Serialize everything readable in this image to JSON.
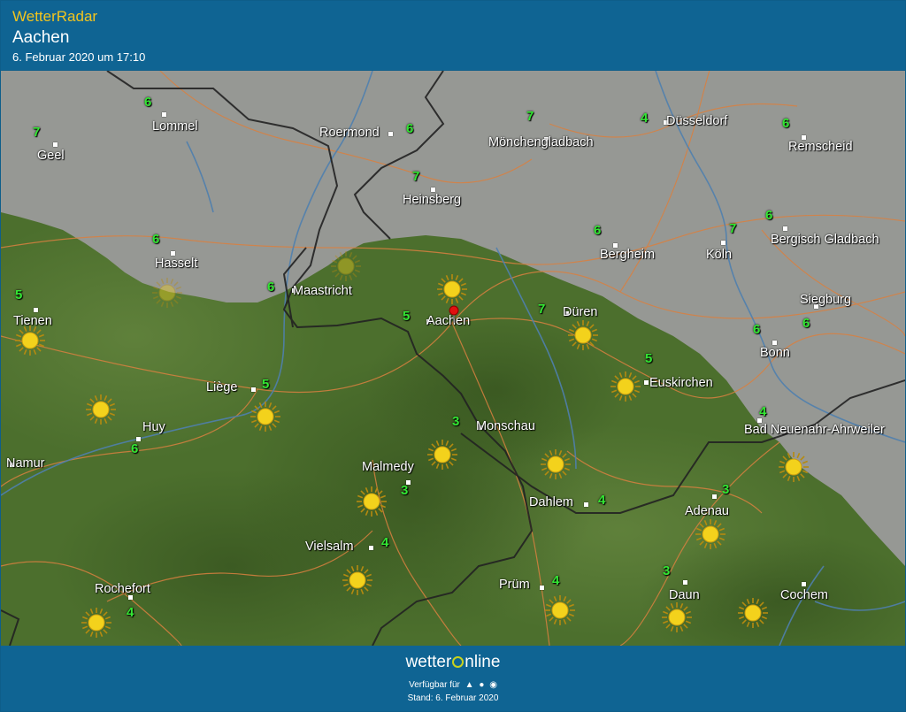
{
  "header": {
    "app_title": "WetterRadar",
    "location": "Aachen",
    "datetime": "6. Februar 2020 um 17:10"
  },
  "map": {
    "places": [
      {
        "name": "Lommel"
      },
      {
        "name": "Geel"
      },
      {
        "name": "Roermond"
      },
      {
        "name": "Mönchengladbach"
      },
      {
        "name": "Düsseldorf"
      },
      {
        "name": "Remscheid"
      },
      {
        "name": "Heinsberg"
      },
      {
        "name": "Hasselt"
      },
      {
        "name": "Bergheim"
      },
      {
        "name": "Köln"
      },
      {
        "name": "Bergisch Gladbach"
      },
      {
        "name": "Maastricht"
      },
      {
        "name": "Tienen"
      },
      {
        "name": "Aachen"
      },
      {
        "name": "Düren"
      },
      {
        "name": "Siegburg"
      },
      {
        "name": "Bonn"
      },
      {
        "name": "Liège"
      },
      {
        "name": "Euskirchen"
      },
      {
        "name": "Huy"
      },
      {
        "name": "Monschau"
      },
      {
        "name": "Bad Neuenahr-Ahrweiler"
      },
      {
        "name": "Namur"
      },
      {
        "name": "Malmedy"
      },
      {
        "name": "Dahlem"
      },
      {
        "name": "Adenau"
      },
      {
        "name": "Vielsalm"
      },
      {
        "name": "Prüm"
      },
      {
        "name": "Rochefort"
      },
      {
        "name": "Daun"
      },
      {
        "name": "Cochem"
      }
    ],
    "temperatures": [
      "6",
      "7",
      "6",
      "7",
      "4",
      "6",
      "7",
      "6",
      "6",
      "7",
      "6",
      "6",
      "5",
      "5",
      "7",
      "6",
      "6",
      "5",
      "5",
      "6",
      "3",
      "4",
      "3",
      "4",
      "4",
      "3",
      "3",
      "4",
      "4"
    ],
    "colors": {
      "precip_overlay": "#9a9a9a",
      "terrain": "#4a6e2c",
      "temp_text": "#33e633",
      "sun": "#f3d21c",
      "border": "#222222",
      "road": "#d98040",
      "river": "#4f7fae"
    },
    "icons": [
      "sun-icon",
      "pin-icon"
    ]
  },
  "footer": {
    "brand_prefix": "wetter",
    "brand_suffix": "nline",
    "available_label": "Verfügbar für",
    "platform_icons": [
      "android-icon",
      "apple-icon",
      "web-icon"
    ],
    "stand": "Stand: 6. Februar 2020"
  }
}
